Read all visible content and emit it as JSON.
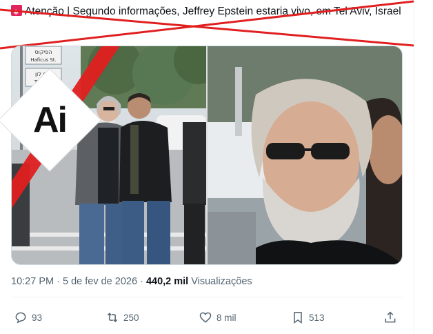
{
  "tweet": {
    "text": "Atenção | Segundo informações, Jeffrey Epstein estaria vivo, em Tel Aviv, Israel",
    "time": "10:27 PM",
    "separator": "·",
    "date": "5 de fev de 2026",
    "views_count": "440,2 mil",
    "views_label": "Visualizações"
  },
  "overlay": {
    "ai_label": "Ai",
    "strike_color": "#e02020"
  },
  "street_signs": {
    "sign1_line1": "הפיקוס",
    "sign1_line2": "Haficus St.",
    "sign2_line1": "חוף לון",
    "sign2_line2": "Tel Aviv"
  },
  "actions": {
    "replies": "93",
    "reposts": "250",
    "likes": "8 mil",
    "bookmarks": "513"
  },
  "icons": [
    "flag-icon",
    "reply-icon",
    "repost-icon",
    "like-icon",
    "bookmark-icon",
    "share-icon"
  ]
}
